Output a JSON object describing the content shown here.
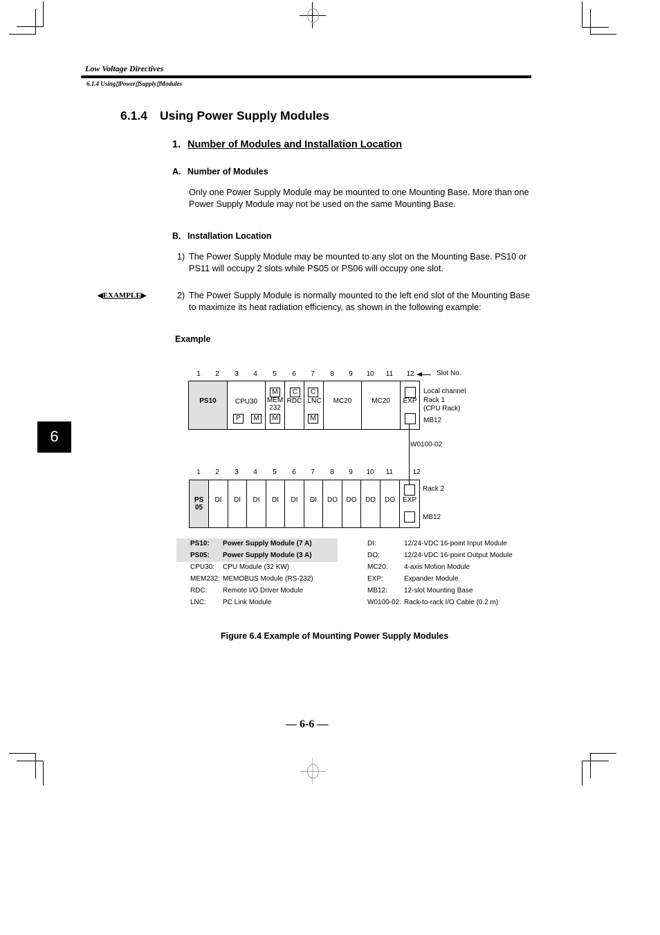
{
  "header": {
    "running_title": "Low Voltage Directives",
    "running_subtitle": "6.1.4 Using▯Power▯Supply▯Modules"
  },
  "section": {
    "number": "6.1.4",
    "title": "Using Power Supply Modules"
  },
  "subsection": {
    "number": "1.",
    "title": "Number of Modules and Installation Location"
  },
  "part_a": {
    "letter": "A.",
    "title": "Number of Modules",
    "text": "Only one Power Supply Module may be mounted to one Mounting Base. More than one Power Supply Module may not be used on the same Mounting Base."
  },
  "part_b": {
    "letter": "B.",
    "title": "Installation Location",
    "items": [
      {
        "num": "1)",
        "text": "The Power Supply Module may be mounted to any slot on the Mounting Base. PS10 or PS11 will occupy 2 slots while PS05 or PS06 will occupy one slot."
      },
      {
        "num": "2)",
        "text": "The Power Supply Module is normally mounted to the left end slot of the Mounting Base to maximize its heat radiation efficiency, as shown in the following example:"
      }
    ]
  },
  "example_tag": {
    "label": "EXAMPLE",
    "left_arrow": "◀",
    "right_arrow": "▶"
  },
  "example_heading": "Example",
  "diagram": {
    "slot_numbers": [
      "1",
      "2",
      "3",
      "4",
      "5",
      "6",
      "7",
      "8",
      "9",
      "10",
      "11",
      "12"
    ],
    "slot_no_label": "Slot No.",
    "rack1": {
      "modules": {
        "ps": "PS10",
        "cpu": "CPU30",
        "cpu_box_p": "P",
        "cpu_box_m": "M",
        "mem_top": "M",
        "mem_line1": "MEM",
        "mem_line2": "232",
        "mem_bottom": "M",
        "rdc_box": "C",
        "rdc": "RDC",
        "lnc_box": "C",
        "lnc": "LNC",
        "lnc_bottom": "M",
        "mc20_a": "MC20",
        "mc20_b": "MC20",
        "exp": "EXP"
      },
      "side_label_1": "Local channel",
      "side_label_2": "Rack 1",
      "side_label_3": "(CPU Rack)",
      "base_label": "MB12"
    },
    "cable_label": "W0100-02",
    "rack2": {
      "modules": [
        "PS 05",
        "DI",
        "DI",
        "DI",
        "DI",
        "DI",
        "DI",
        "DO",
        "DO",
        "DO",
        "DO",
        "EXP"
      ],
      "ps_line1": "PS",
      "ps_line2": "05",
      "side_label": "Rack 2",
      "base_label": "MB12"
    }
  },
  "legend": {
    "left": [
      {
        "key": "PS10:",
        "value": "Power Supply Module (7 A)",
        "highlight": true
      },
      {
        "key": "PS05:",
        "value": "Power Supply Module (3 A)",
        "highlight": true
      },
      {
        "key": "CPU30:",
        "value": "CPU Module (32 KW)"
      },
      {
        "key": "MEM232:",
        "value": "MEMOBUS Module (RS-232)"
      },
      {
        "key": "RDC:",
        "value": "Remote I/O Driver Module"
      },
      {
        "key": "LNC:",
        "value": "PC Link Module"
      }
    ],
    "right": [
      {
        "key": "DI:",
        "value": "12/24-VDC 16-point Input Module"
      },
      {
        "key": "DO:",
        "value": "12/24-VDC 16-point Output Module"
      },
      {
        "key": "MC20:",
        "value": "4-axis Motion Module"
      },
      {
        "key": "EXP:",
        "value": "Expander Module"
      },
      {
        "key": "MB12:",
        "value": "12-slot Mounting Base"
      },
      {
        "key": "W0100-02:",
        "value": "Rack-to-rack I/O Cable (0.2 m)"
      }
    ]
  },
  "figure_caption": "Figure 6.4 Example of Mounting Power Supply Modules",
  "page_number": "— 6-6 —",
  "chapter_tab": "6"
}
